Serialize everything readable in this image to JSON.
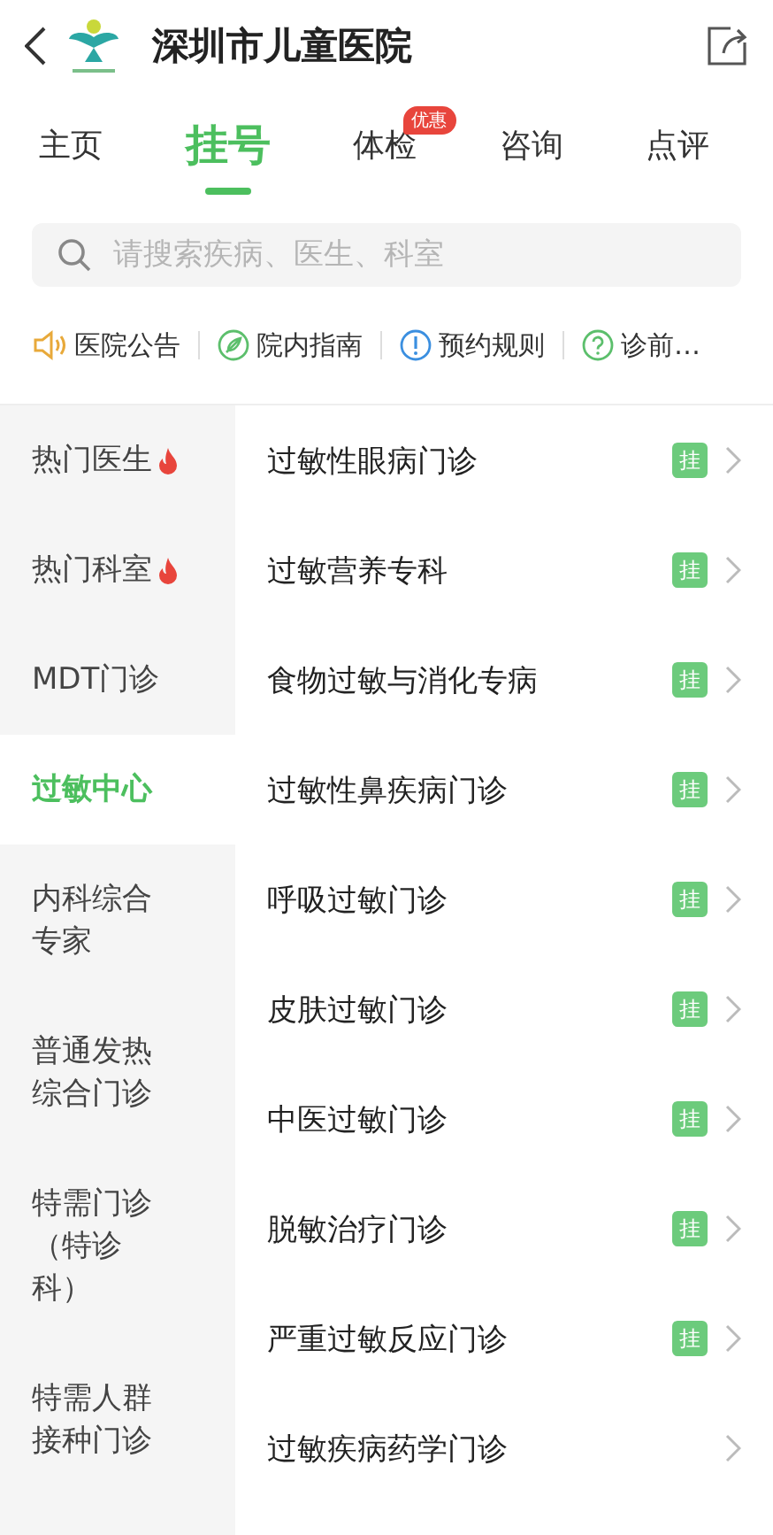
{
  "header": {
    "title": "深圳市儿童医院"
  },
  "tabs": [
    {
      "label": "主页",
      "selected": false
    },
    {
      "label": "挂号",
      "selected": true
    },
    {
      "label": "体检",
      "selected": false,
      "badge": "优惠"
    },
    {
      "label": "咨询",
      "selected": false
    },
    {
      "label": "点评",
      "selected": false
    }
  ],
  "search": {
    "placeholder": "请搜索疾病、医生、科室"
  },
  "shortcuts": [
    {
      "label": "医院公告",
      "kind": "speaker"
    },
    {
      "label": "院内指南",
      "kind": "compass"
    },
    {
      "label": "预约规则",
      "kind": "info"
    },
    {
      "label": "诊前…",
      "kind": "help"
    }
  ],
  "sidebar": [
    {
      "label": "热门医生",
      "hot": true,
      "selected": false
    },
    {
      "label": "热门科室",
      "hot": true,
      "selected": false
    },
    {
      "label": "MDT门诊",
      "hot": false,
      "selected": false
    },
    {
      "label": "过敏中心",
      "hot": false,
      "selected": true
    },
    {
      "label": "内科综合专家",
      "hot": false,
      "selected": false
    },
    {
      "label": "普通发热综合门诊",
      "hot": false,
      "selected": false
    },
    {
      "label": "特需门诊（特诊科）",
      "hot": false,
      "selected": false
    },
    {
      "label": "特需人群接种门诊",
      "hot": false,
      "selected": false
    }
  ],
  "clinics": [
    {
      "name": "过敏性眼病门诊",
      "badge": "挂"
    },
    {
      "name": "过敏营养专科",
      "badge": "挂"
    },
    {
      "name": "食物过敏与消化专病",
      "badge": "挂"
    },
    {
      "name": "过敏性鼻疾病门诊",
      "badge": "挂"
    },
    {
      "name": "呼吸过敏门诊",
      "badge": "挂"
    },
    {
      "name": "皮肤过敏门诊",
      "badge": "挂"
    },
    {
      "name": "中医过敏门诊",
      "badge": "挂"
    },
    {
      "name": "脱敏治疗门诊",
      "badge": "挂"
    },
    {
      "name": "严重过敏反应门诊",
      "badge": "挂"
    },
    {
      "name": "过敏疾病药学门诊"
    }
  ]
}
